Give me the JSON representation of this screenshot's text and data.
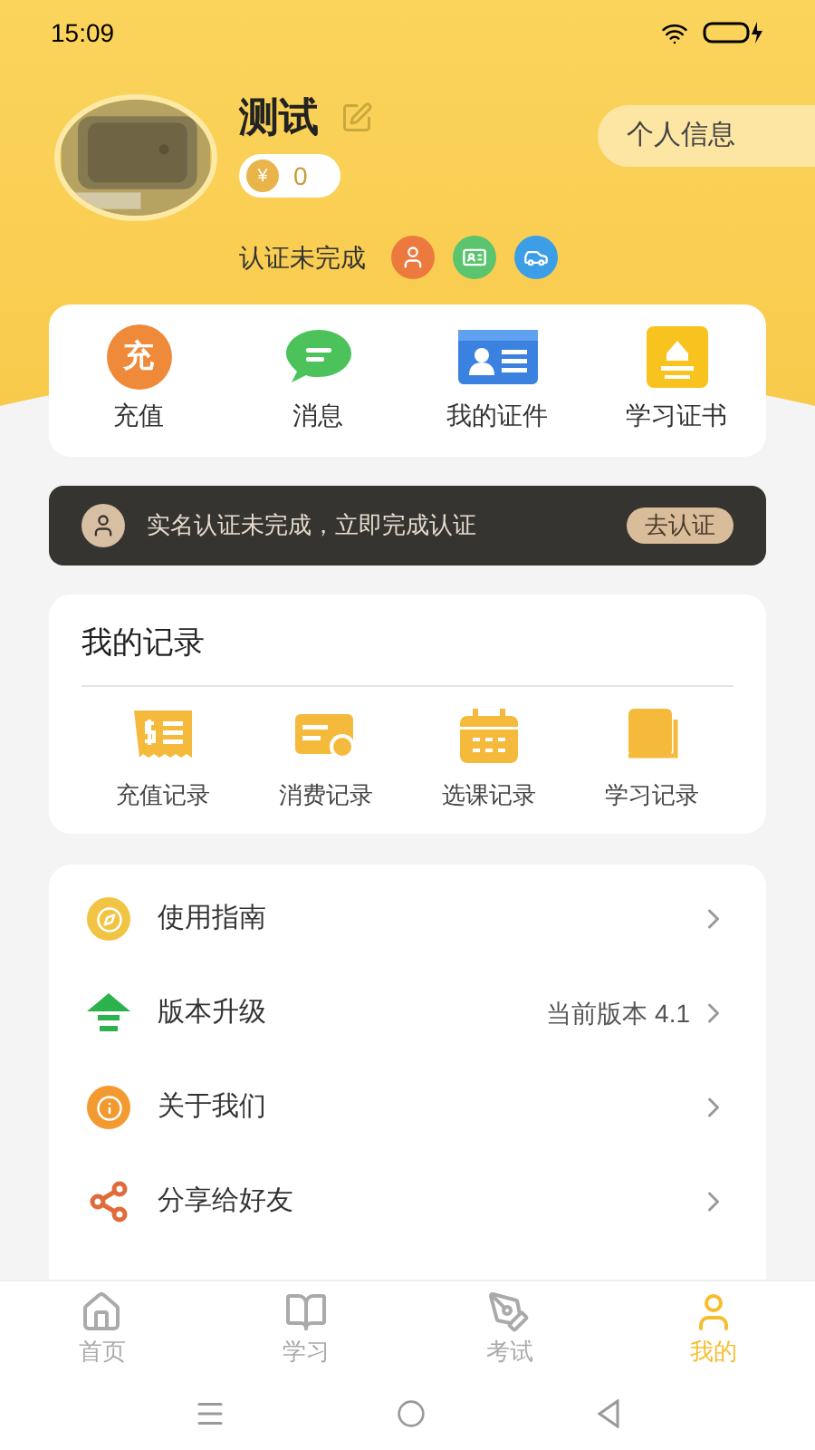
{
  "status_bar": {
    "time": "15:09"
  },
  "profile": {
    "name": "测试",
    "coins": "0",
    "coin_symbol": "¥",
    "info_button": "个人信息",
    "verify_status": "认证未完成"
  },
  "quick_actions": [
    {
      "label": "充值",
      "kind": "recharge",
      "icon_text": "充"
    },
    {
      "label": "消息",
      "kind": "message"
    },
    {
      "label": "我的证件",
      "kind": "id"
    },
    {
      "label": "学习证书",
      "kind": "certificate"
    }
  ],
  "banner": {
    "text": "实名认证未完成，立即完成认证",
    "button": "去认证"
  },
  "records": {
    "title": "我的记录",
    "items": [
      {
        "label": "充值记录",
        "kind": "recharge"
      },
      {
        "label": "消费记录",
        "kind": "spend"
      },
      {
        "label": "选课记录",
        "kind": "course"
      },
      {
        "label": "学习记录",
        "kind": "study"
      }
    ]
  },
  "menu": [
    {
      "label": "使用指南",
      "kind": "guide"
    },
    {
      "label": "版本升级",
      "kind": "upgrade",
      "value": "当前版本 4.1"
    },
    {
      "label": "关于我们",
      "kind": "about"
    },
    {
      "label": "分享给好友",
      "kind": "share"
    }
  ],
  "tab_bar": [
    {
      "label": "首页",
      "kind": "home",
      "selected": false
    },
    {
      "label": "学习",
      "kind": "study",
      "selected": false
    },
    {
      "label": "考试",
      "kind": "exam",
      "selected": false
    },
    {
      "label": "我的",
      "kind": "me",
      "selected": true
    }
  ]
}
